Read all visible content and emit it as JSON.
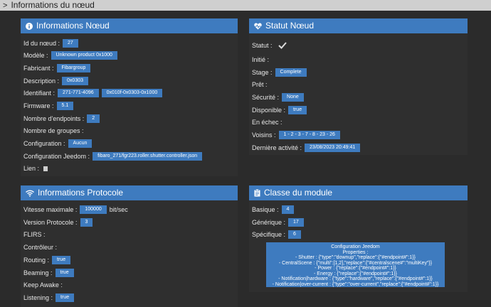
{
  "window": {
    "title": "Informations du nœud"
  },
  "panels": {
    "node": {
      "title": "Informations Nœud",
      "rows": [
        {
          "label": "Id du nœud :",
          "values": [
            "27"
          ]
        },
        {
          "label": "Modèle :",
          "values": [
            "Unknown product 0x1000"
          ]
        },
        {
          "label": "Fabricant :",
          "values": [
            "Fibargroup"
          ]
        },
        {
          "label": "Description :",
          "values": [
            "0x0303"
          ]
        },
        {
          "label": "Identifiant :",
          "values": [
            "271-771-4096",
            "0x010f-0x0303-0x1000"
          ]
        },
        {
          "label": "Firmware :",
          "values": [
            "5.1"
          ]
        },
        {
          "label": "Nombre d'endpoints :",
          "values": [
            "2"
          ]
        },
        {
          "label": "Nombre de groupes :",
          "values": []
        },
        {
          "label": "Configuration :",
          "values": [
            "Aucun"
          ]
        },
        {
          "label": "Configuration Jeedom :",
          "values": [
            "fibaro_271/fgr223.roller.shutter.controller.json"
          ]
        },
        {
          "label": "Lien :",
          "values": []
        }
      ]
    },
    "status": {
      "title": "Statut Nœud",
      "rows": [
        {
          "label": "Statut :",
          "values": []
        },
        {
          "label": "Initié :",
          "values": []
        },
        {
          "label": "Stage :",
          "values": [
            "Complete"
          ]
        },
        {
          "label": "Prêt :",
          "values": []
        },
        {
          "label": "Sécurité :",
          "values": [
            "None"
          ]
        },
        {
          "label": "Disponible :",
          "values": [
            "true"
          ]
        },
        {
          "label": "En échec :",
          "values": []
        },
        {
          "label": "Voisins :",
          "values": [
            "1 - 2 - 3 - 7 - 8 - 23 - 26"
          ]
        },
        {
          "label": "Dernière activité :",
          "values": [
            "23/08/2023 20:49:41"
          ]
        }
      ]
    },
    "protocol": {
      "title": "Informations Protocole",
      "rows": [
        {
          "label": "Vitesse maximale :",
          "values": [
            "100000"
          ],
          "unit": "bit/sec"
        },
        {
          "label": "Version Protocole :",
          "values": [
            "3"
          ]
        },
        {
          "label": "FLIRS :",
          "values": []
        },
        {
          "label": "Contrôleur :",
          "values": []
        },
        {
          "label": "Routing :",
          "values": [
            "true"
          ]
        },
        {
          "label": "Beaming :",
          "values": [
            "true"
          ]
        },
        {
          "label": "Keep Awake :",
          "values": []
        },
        {
          "label": "Listening :",
          "values": [
            "true"
          ]
        }
      ]
    },
    "module": {
      "title": "Classe du module",
      "rows": [
        {
          "label": "Basique :",
          "values": [
            "4"
          ]
        },
        {
          "label": "Générique :",
          "values": [
            "17"
          ]
        },
        {
          "label": "Spécifique :",
          "values": [
            "6"
          ]
        }
      ],
      "config_lines": [
        "Configuration Jeedom",
        "Properties :",
        "- Shutter : {\"type\":\"downup\",\"replace\":{\"#endpoint#\":1}}",
        "- CentralScene : {\"multi\":[1,2],\"replace\":{\"#centralscene#\":\"multiKey\"}}",
        "- Power : {\"replace\":{\"#endpoint#\":1}}",
        "- Energy : {\"replace\":{\"#endpoint#\":1}}",
        "- Notification|hardware : {\"type\":\"hardware\",\"replace\":{\"#endpoint#\":1}}",
        "- Notification|over-current : {\"type\":\"over-current\",\"replace\":{\"#endpoint#\":1}}"
      ]
    }
  },
  "colors": {
    "header": "#3e7bbf",
    "background": "#2b2b2b",
    "badge": "#3e7bbf"
  }
}
